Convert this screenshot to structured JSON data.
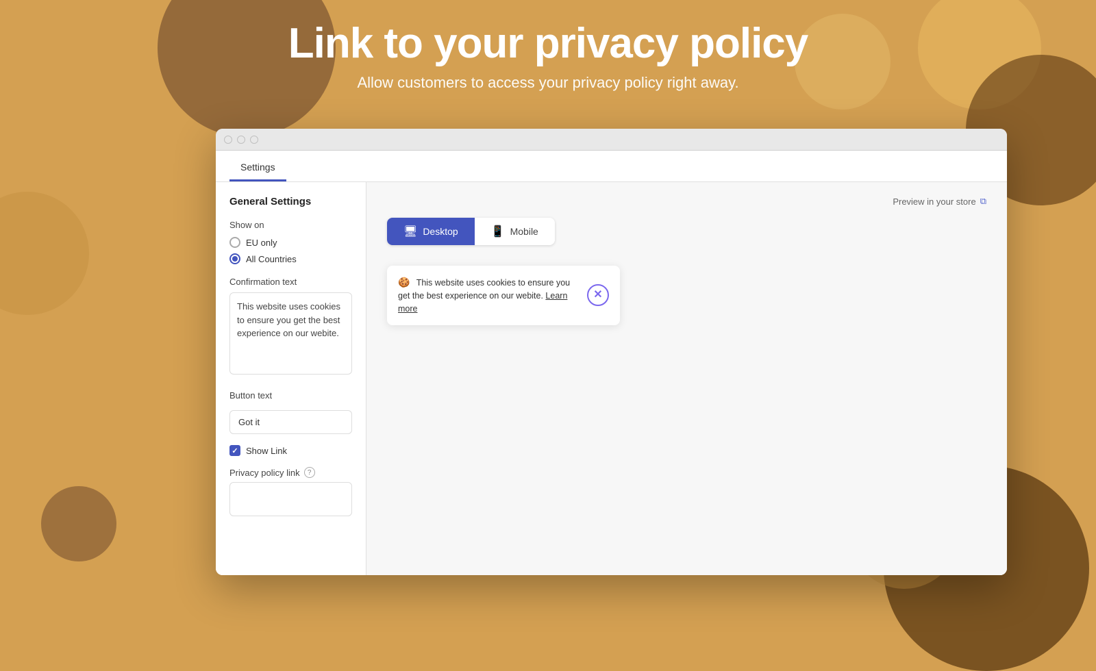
{
  "background": {
    "color": "#D4A052"
  },
  "header": {
    "title": "Link to your privacy policy",
    "subtitle": "Allow customers to access your privacy policy right away."
  },
  "window": {
    "tabs": [
      {
        "label": "Settings",
        "active": true
      }
    ]
  },
  "settings": {
    "section_title": "General Settings",
    "show_on_label": "Show on",
    "options": [
      {
        "label": "EU only",
        "checked": false
      },
      {
        "label": "All Countries",
        "checked": true
      }
    ],
    "confirmation_label": "Confirmation text",
    "confirmation_text": "This website uses cookies to ensure you get the best experience on our webite.",
    "button_text_label": "Button text",
    "button_text_value": "Got it",
    "show_link_label": "Show Link",
    "show_link_checked": true,
    "privacy_policy_label": "Privacy policy link",
    "privacy_policy_help": "?",
    "privacy_policy_value": ""
  },
  "preview": {
    "header_text": "Preview in your store",
    "desktop_label": "Desktop",
    "mobile_label": "Mobile",
    "active_device": "desktop",
    "cookie_banner": {
      "emoji": "🍪",
      "text": "This website uses cookies to ensure you get the best experience on our webite.",
      "link_text": "Learn more"
    }
  },
  "icons": {
    "external_link": "⧉",
    "desktop": "🖥",
    "mobile": "📱",
    "close": "✕"
  }
}
